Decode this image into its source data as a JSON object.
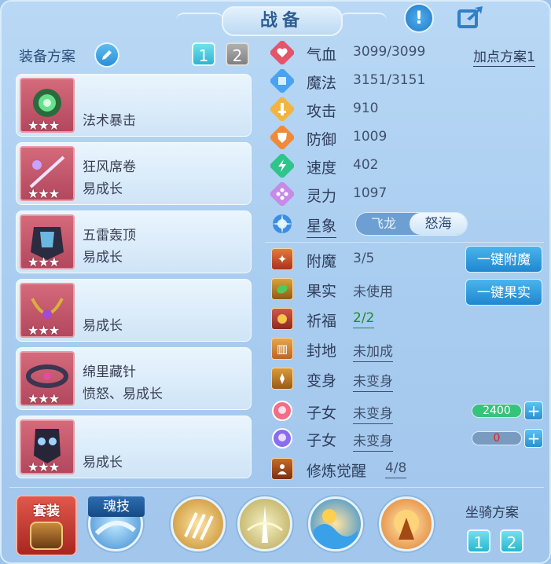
{
  "window": {
    "title": "战备"
  },
  "header": {
    "info_icon": "exclamation-icon",
    "share_icon": "share-arrow-icon"
  },
  "equipment": {
    "label": "装备方案",
    "plan_buttons": [
      "1",
      "2"
    ],
    "items": [
      {
        "name": "",
        "trait": "法术暴击",
        "stars": "★★★",
        "icon": "green-orb-icon"
      },
      {
        "name": "狂风席卷",
        "trait": "易成长",
        "stars": "★★★",
        "icon": "spear-icon"
      },
      {
        "name": "五雷轰顶",
        "trait": "易成长",
        "stars": "★★★",
        "icon": "armor-icon"
      },
      {
        "name": "",
        "trait": "易成长",
        "stars": "★★★",
        "icon": "necklace-icon"
      },
      {
        "name": "绵里藏针",
        "trait": "愤怒、易成长",
        "stars": "★★★",
        "icon": "belt-icon"
      },
      {
        "name": "",
        "trait": "易成长",
        "stars": "★★★",
        "icon": "boots-icon"
      }
    ]
  },
  "stats": {
    "points_plan": "加点方案1",
    "rows": [
      {
        "name": "气血",
        "value": "3099/3099",
        "icon": "heart-icon",
        "color": "#e5556a"
      },
      {
        "name": "魔法",
        "value": "3151/3151",
        "icon": "mana-diamond-icon",
        "color": "#4aa3f0"
      },
      {
        "name": "攻击",
        "value": "910",
        "icon": "sword-icon",
        "color": "#f2b441"
      },
      {
        "name": "防御",
        "value": "1009",
        "icon": "shield-icon",
        "color": "#f08a3a"
      },
      {
        "name": "速度",
        "value": "402",
        "icon": "speed-bolt-icon",
        "color": "#2ec48a"
      },
      {
        "name": "灵力",
        "value": "1097",
        "icon": "spirit-icon",
        "color": "#c78ae8"
      }
    ],
    "constellation": {
      "name": "星象",
      "options": [
        "飞龙",
        "怒海"
      ],
      "selected": "怒海"
    }
  },
  "enhance": {
    "rows": [
      {
        "name": "附魔",
        "value": "3/5",
        "icon": "enchant-icon"
      },
      {
        "name": "果实",
        "value": "未使用",
        "icon": "fruit-icon"
      },
      {
        "name": "祈福",
        "value": "2/2",
        "icon": "blessing-icon"
      },
      {
        "name": "封地",
        "value": "未加成",
        "icon": "fief-gate-icon"
      },
      {
        "name": "变身",
        "value": "未变身",
        "icon": "transform-icon"
      },
      {
        "name": "子女",
        "value": "未变身",
        "icon": "child-girl-icon"
      },
      {
        "name": "子女",
        "value": "未变身",
        "icon": "child-boy-icon"
      },
      {
        "name": "修炼觉醒",
        "value": "4/8",
        "icon": "cultivation-icon"
      }
    ],
    "enchant_button": "一键附魔",
    "fruit_button": "一键果实",
    "child_bars": [
      {
        "value": "2400",
        "fill": 1.0,
        "color": "#37c47a"
      },
      {
        "value": "0",
        "fill": 0.0,
        "color": "#e02424"
      }
    ]
  },
  "bottom": {
    "set_label": "套装",
    "soul_skill_label": "魂技",
    "mount_label": "坐骑方案",
    "mount_buttons": [
      "1",
      "2"
    ],
    "skill_icons": [
      "claw-skill-icon",
      "light-skill-icon",
      "wave-skill-icon",
      "fire-skill-icon"
    ]
  }
}
